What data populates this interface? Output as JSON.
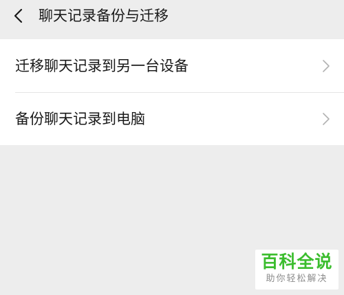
{
  "header": {
    "title": "聊天记录备份与迁移",
    "back_icon": "chevron-left-icon"
  },
  "menu": {
    "items": [
      {
        "label": "迁移聊天记录到另一台设备",
        "icon": "chevron-right-icon"
      },
      {
        "label": "备份聊天记录到电脑",
        "icon": "chevron-right-icon"
      }
    ]
  },
  "watermark": {
    "title": "百科全说",
    "subtitle": "助你轻松解决"
  },
  "colors": {
    "background": "#ededed",
    "card": "#ffffff",
    "text": "#191919",
    "chevron": "#b2b2b2",
    "watermark_green": "#3bbd2e"
  }
}
